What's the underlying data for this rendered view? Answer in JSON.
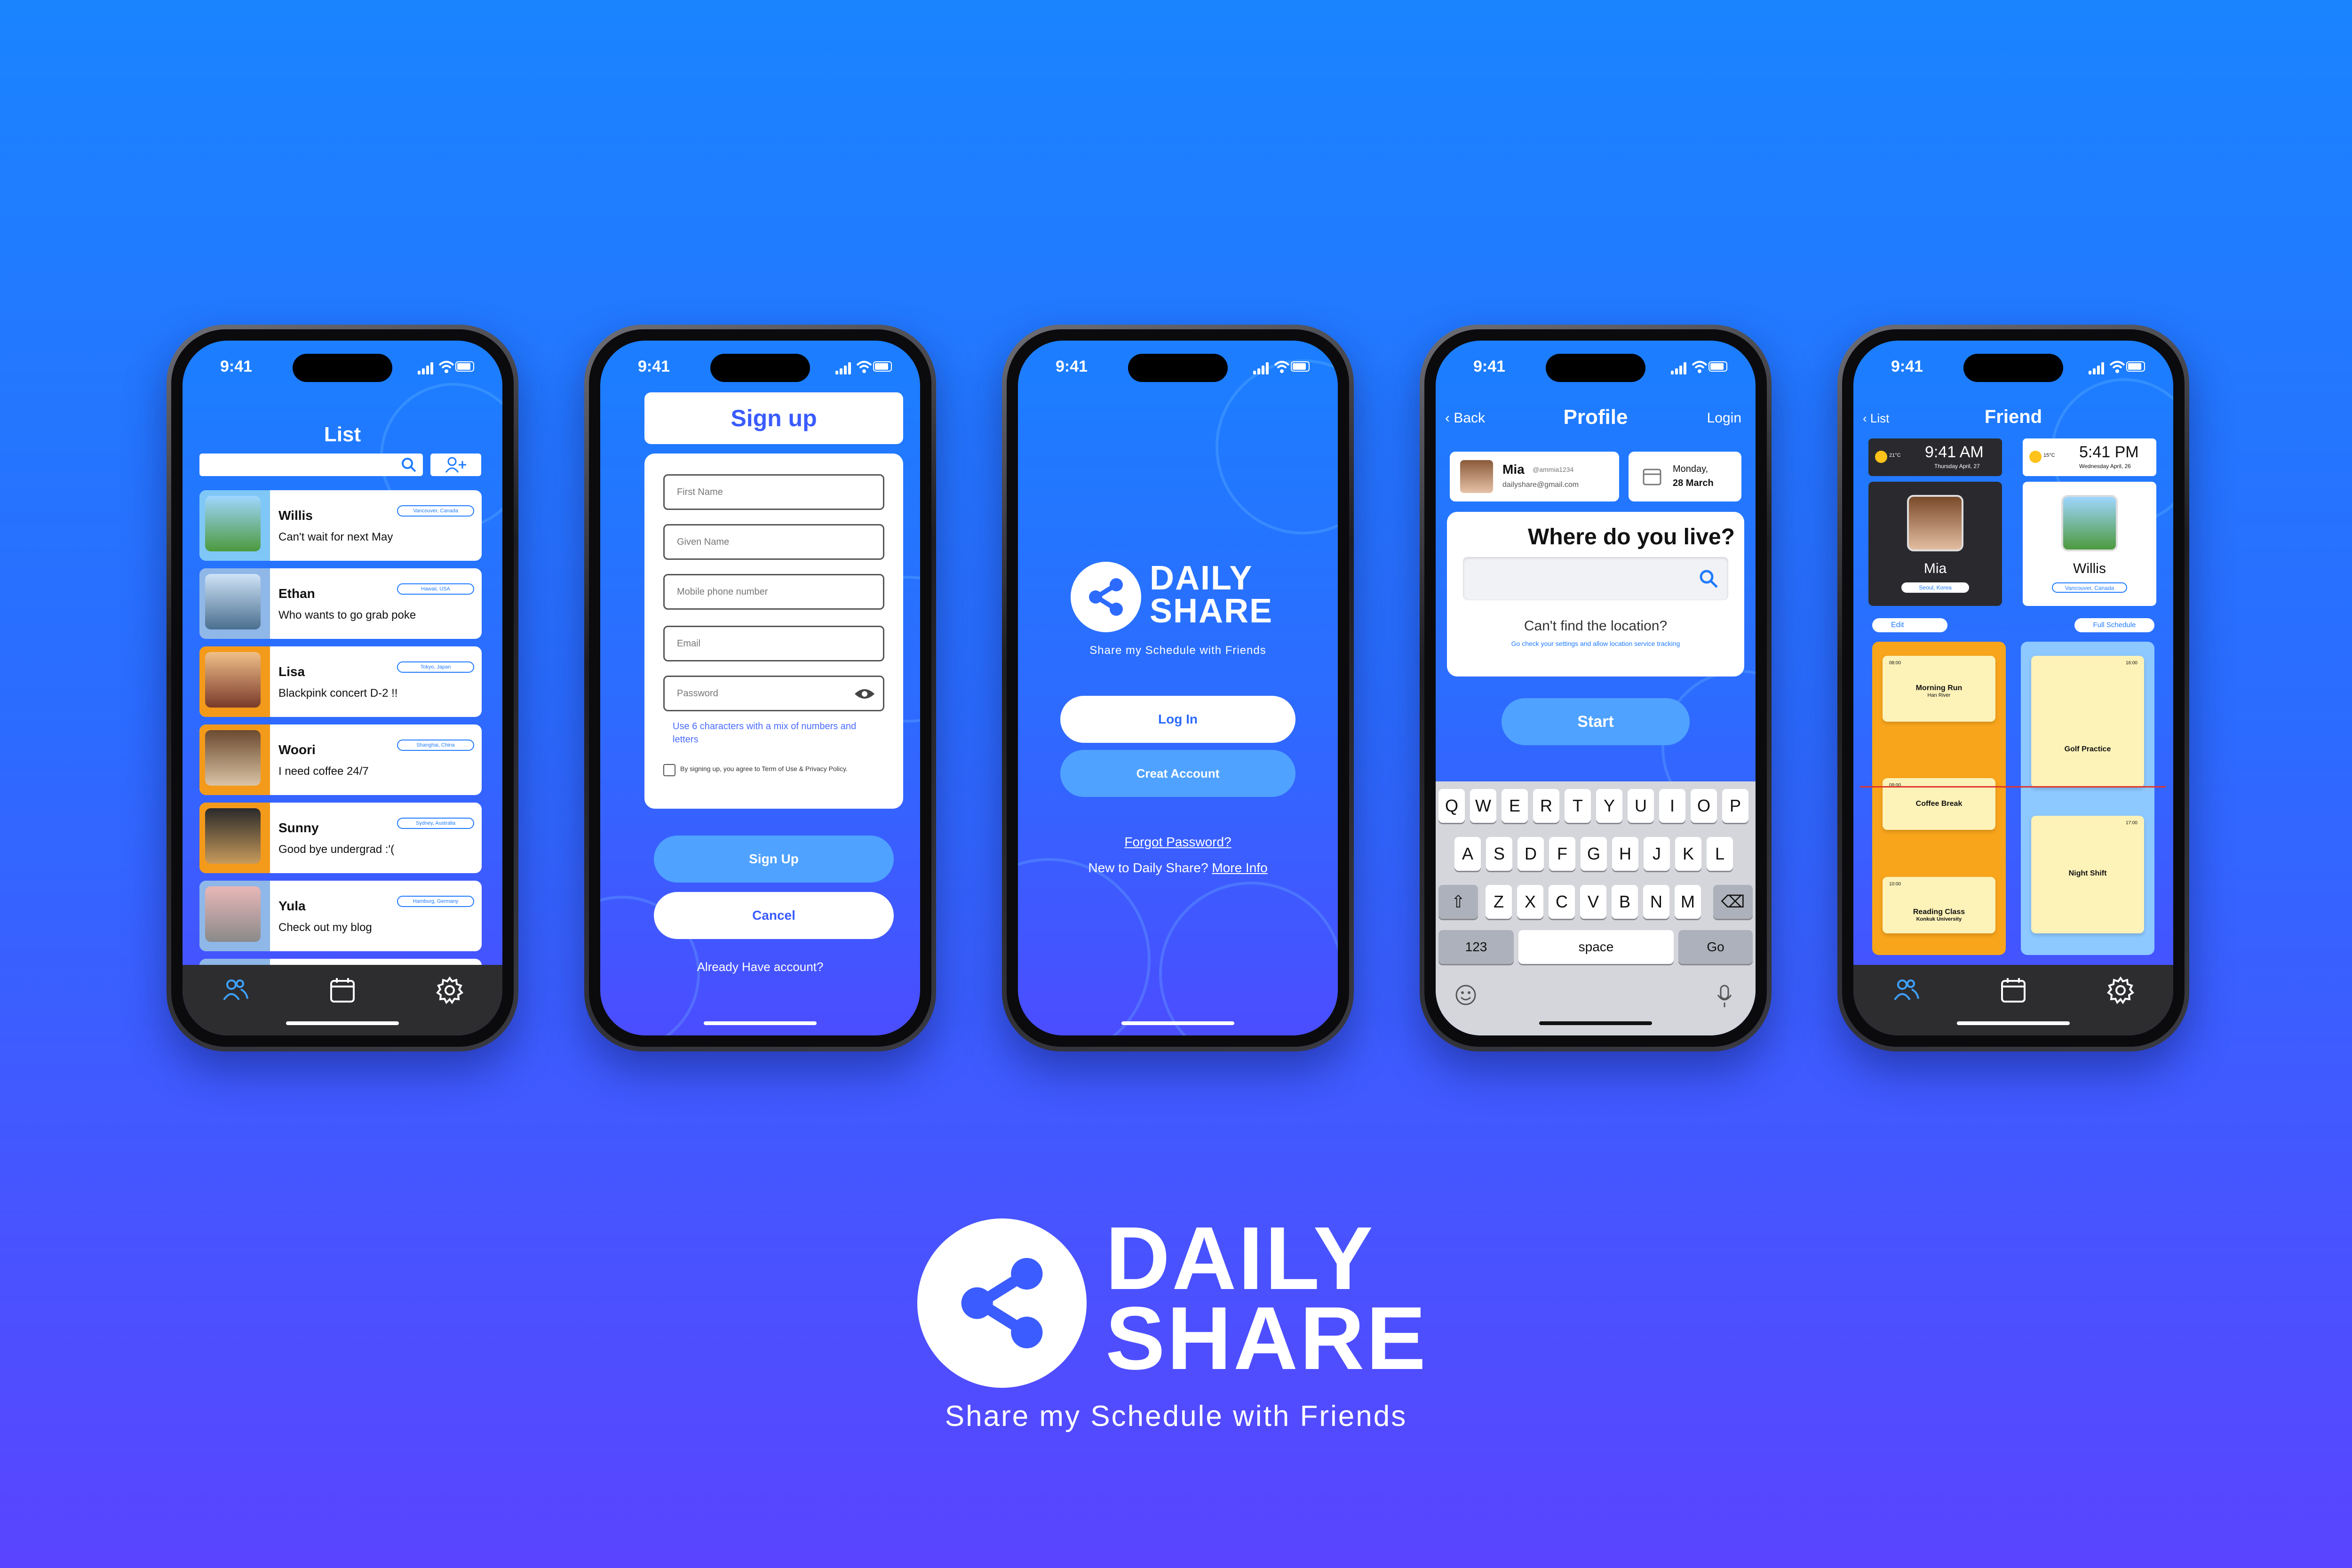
{
  "status_time": "9:41",
  "phones": {
    "list": {
      "title": "List",
      "rows": [
        {
          "name": "Willis",
          "msg": "Can't wait for next May",
          "loc": "Vancouver, Canada"
        },
        {
          "name": "Ethan",
          "msg": "Who wants to go grab poke",
          "loc": "Hawaii, USA"
        },
        {
          "name": "Lisa",
          "msg": "Blackpink concert D-2 !!",
          "loc": "Tokyo, Japan"
        },
        {
          "name": "Woori",
          "msg": "I need coffee 24/7",
          "loc": "Shanghai, China"
        },
        {
          "name": "Sunny",
          "msg": "Good bye undergrad :'(",
          "loc": "Sydney, Australia"
        },
        {
          "name": "Yula",
          "msg": "Check out my blog",
          "loc": "Hamburg, Germany"
        }
      ]
    },
    "signup": {
      "title": "Sign up",
      "fields": [
        "First Name",
        "Given Name",
        "Mobile phone number",
        "Email",
        "Password"
      ],
      "hint": "Use 6 characters with a mix of numbers and letters",
      "terms": "By signing up, you agree to Term of Use & Privacy Policy.",
      "signup_button": "Sign Up",
      "cancel_button": "Cancel",
      "already": "Already Have account?"
    },
    "welcome": {
      "brand_line1": "DAILY",
      "brand_line2": "SHARE",
      "tagline": "Share my Schedule with Friends",
      "login_button": "Log In",
      "create_button": "Creat Account",
      "forgot": "Forgot Password?",
      "new_to": "New to Daily Share?",
      "more_info": "More Info"
    },
    "profile": {
      "back": "Back",
      "title": "Profile",
      "login": "Login",
      "user_name": "Mia",
      "user_handle": "@ammia1234",
      "user_email": "dailyshare@gmail.com",
      "date_line1": "Monday,",
      "date_line2": "28 March",
      "question": "Where do you live?",
      "cant_find": "Can't find the location?",
      "cant_find_sub": "Go check your settings and allow location service tracking",
      "start_button": "Start",
      "kb_row1": [
        "Q",
        "W",
        "E",
        "R",
        "T",
        "Y",
        "U",
        "I",
        "O",
        "P"
      ],
      "kb_row2": [
        "A",
        "S",
        "D",
        "F",
        "G",
        "H",
        "J",
        "K",
        "L"
      ],
      "kb_row3": [
        "Z",
        "X",
        "C",
        "V",
        "B",
        "N",
        "M"
      ],
      "kb_123": "123",
      "kb_space": "space",
      "kb_go": "Go"
    },
    "friend": {
      "back": "List",
      "title": "Friend",
      "clock1_time": "9:41 AM",
      "clock1_date": "Thursday April, 27",
      "clock1_temp": "21°C",
      "clock2_time": "5:41 PM",
      "clock2_date": "Wednesday April, 26",
      "clock2_temp": "15°C",
      "person1_name": "Mia",
      "person1_loc": "Seoul, Korea",
      "person2_name": "Willis",
      "person2_loc": "Vancouver, Canada",
      "edit": "Edit",
      "full_schedule": "Full Schedule",
      "left_events": [
        {
          "title": "Morning Run",
          "sub": "Han River",
          "t1": "08:00",
          "t2": "08:30"
        },
        {
          "title": "Coffee Break",
          "sub": "",
          "t1": "09:00",
          "t2": "09:30"
        },
        {
          "title": "Reading Class",
          "sub": "Konkuk University",
          "t1": "10:00",
          "t2": ""
        }
      ],
      "right_events": [
        {
          "title": "Golf Practice",
          "t1": "16:00",
          "t2": "16:30"
        },
        {
          "title": "Night Shift",
          "t1": "17:00",
          "t2": "17:30"
        }
      ]
    }
  },
  "brand": {
    "line1": "DAILY",
    "line2": "SHARE",
    "tagline": "Share my Schedule with Friends"
  }
}
